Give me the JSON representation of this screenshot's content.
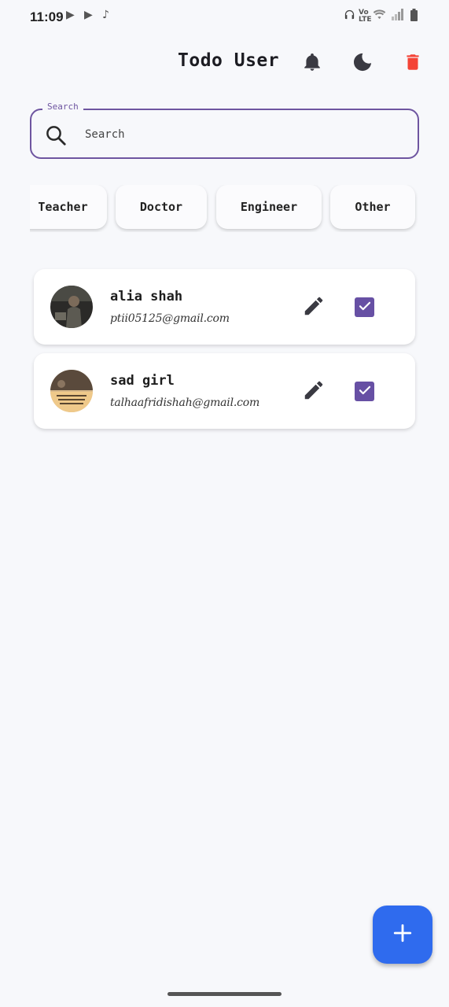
{
  "status_bar": {
    "time": "11:09",
    "left_icons": [
      "play-store-icon",
      "play-store-icon",
      "tiktok-icon"
    ],
    "right_icons": [
      "headphones-icon",
      "volte-icon",
      "wifi-icon",
      "signal-icon",
      "battery-icon"
    ]
  },
  "app_bar": {
    "title": "Todo User",
    "actions": [
      "bell-icon",
      "moon-icon",
      "delete-icon"
    ],
    "delete_color": "#f44336"
  },
  "search": {
    "label": "Search",
    "placeholder": "Search",
    "value": ""
  },
  "filters": [
    {
      "label": "Teacher"
    },
    {
      "label": "Doctor"
    },
    {
      "label": "Engineer"
    },
    {
      "label": "Other"
    }
  ],
  "users": [
    {
      "name": "alia shah",
      "email": "ptii05125@gmail.com",
      "checked": true
    },
    {
      "name": "sad girl",
      "email": "talhaafridishah@gmail.com",
      "checked": true
    }
  ],
  "colors": {
    "accent": "#6750a4",
    "fab": "#2f6bee",
    "background": "#f7f8fb"
  },
  "fab": {
    "icon": "plus-icon"
  }
}
